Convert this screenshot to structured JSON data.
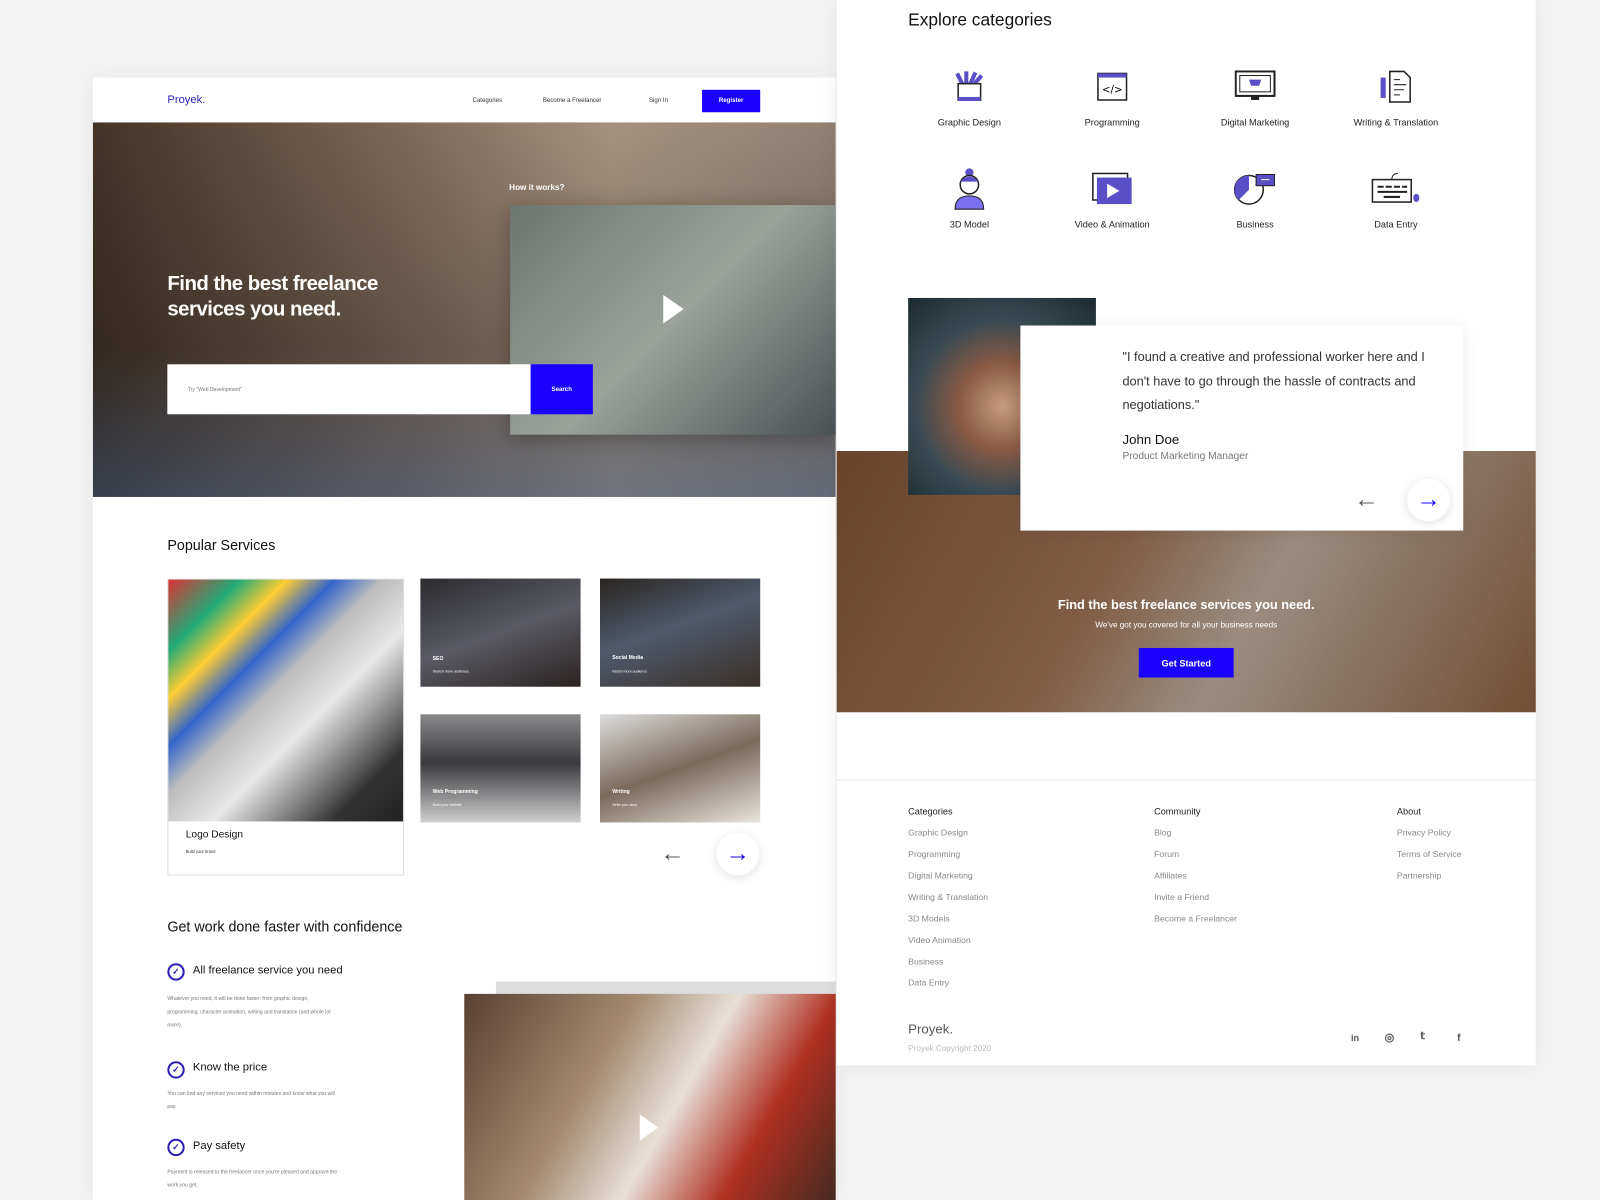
{
  "brand": "Proyek.",
  "colors": {
    "accent": "#1a00ff",
    "icon": "#5b4fc7"
  },
  "nav": {
    "items": [
      "Categories",
      "Become a Freelancer",
      "Sign In"
    ],
    "register": "Register"
  },
  "hero": {
    "title": "Find the best freelance services you need.",
    "search_placeholder": "Try \"Web Development\"",
    "search_button": "Search",
    "video_label": "How it works?"
  },
  "popular": {
    "title": "Popular Services",
    "featured": {
      "title": "Logo Design",
      "subtitle": "Build your brand"
    },
    "tiles": [
      {
        "title": "SEO",
        "subtitle": "Search more audience"
      },
      {
        "title": "Social Media",
        "subtitle": "Reach more audience"
      },
      {
        "title": "Web Programming",
        "subtitle": "Build your website"
      },
      {
        "title": "Writing",
        "subtitle": "Write your story"
      }
    ]
  },
  "features": {
    "title": "Get work done faster with confidence",
    "items": [
      {
        "title": "All freelance service you need",
        "text": "Whatever you need, it will be done faster: from graphic design, programming, character animation, writing and translation (and whole lot more)."
      },
      {
        "title": "Know the price",
        "text": "You can find any services you need within minutes and know what you will pay."
      },
      {
        "title": "Pay safety",
        "text": "Payment is released to the freelancer once you're pleased and approve the work you get."
      }
    ]
  },
  "categories": {
    "title": "Explore categories",
    "items": [
      {
        "label": "Graphic Design",
        "icon": "pencil-cup-icon"
      },
      {
        "label": "Programming",
        "icon": "code-window-icon"
      },
      {
        "label": "Digital Marketing",
        "icon": "monitor-cart-icon"
      },
      {
        "label": "Writing & Translation",
        "icon": "document-pen-icon"
      },
      {
        "label": "3D Model",
        "icon": "person-icon"
      },
      {
        "label": "Video & Animation",
        "icon": "video-play-icon"
      },
      {
        "label": "Business",
        "icon": "pie-chart-icon"
      },
      {
        "label": "Data Entry",
        "icon": "keyboard-icon"
      }
    ]
  },
  "testimonial": {
    "quote": "\"I found a creative and professional worker here and I don't have to go through the hassle of contracts and negotiations.\"",
    "name": "John Doe",
    "role": "Product Marketing Manager"
  },
  "cta": {
    "title": "Find the best freelance services you need.",
    "subtitle": "We've got you covered for all your business needs",
    "button": "Get Started"
  },
  "footer": {
    "columns": [
      {
        "title": "Categories",
        "links": [
          "Graphic Design",
          "Programming",
          "Digital Marketing",
          "Writing & Translation",
          "3D Models",
          "Video Animation",
          "Business",
          "Data Entry"
        ]
      },
      {
        "title": "Community",
        "links": [
          "Blog",
          "Forum",
          "Affiliates",
          "Invite a Friend",
          "Become a Freelancer"
        ]
      },
      {
        "title": "About",
        "links": [
          "Privacy Policy",
          "Terms of Service",
          "Partnership"
        ]
      }
    ],
    "brand": "Proyek.",
    "copyright": "Proyek Copyright 2020",
    "social": [
      "linkedin",
      "dribbble",
      "twitter",
      "facebook"
    ]
  }
}
